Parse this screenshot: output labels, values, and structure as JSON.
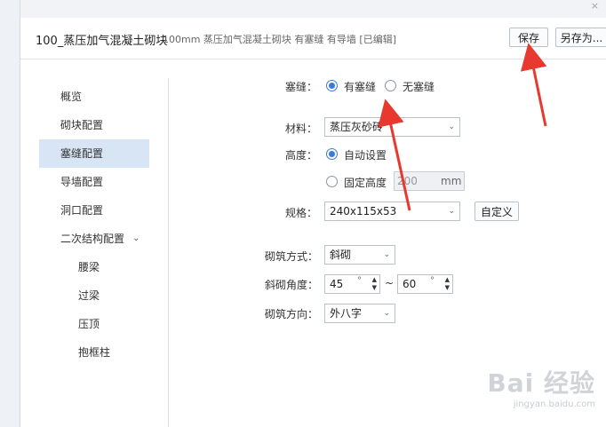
{
  "window": {
    "title": "100_蒸压加气混凝土砌块",
    "subtitle": "100mm 蒸压加气混凝土砌块 有塞缝 有导墙 [已编辑]",
    "close_glyph": "×"
  },
  "toolbar": {
    "save_label": "保存",
    "save_as_label": "另存为..."
  },
  "sidebar": {
    "items": [
      {
        "label": "概览"
      },
      {
        "label": "砌块配置"
      },
      {
        "label": "塞缝配置"
      },
      {
        "label": "导墙配置"
      },
      {
        "label": "洞口配置"
      },
      {
        "label": "二次结构配置"
      },
      {
        "label": "腰梁"
      },
      {
        "label": "过梁"
      },
      {
        "label": "压顶"
      },
      {
        "label": "抱框柱"
      }
    ],
    "active_index": 2,
    "chevron": "⌄"
  },
  "form": {
    "caulk": {
      "label": "塞缝：",
      "options": [
        "有塞缝",
        "无塞缝"
      ],
      "selected": "有塞缝"
    },
    "material": {
      "label": "材料：",
      "value": "蒸压灰砂砖"
    },
    "height": {
      "label": "高度：",
      "options": [
        "自动设置",
        "固定高度"
      ],
      "selected": "自动设置",
      "fixed_value": "200",
      "unit": "mm"
    },
    "spec": {
      "label": "规格：",
      "value": "240x115x53",
      "custom_label": "自定义"
    },
    "method": {
      "label": "砌筑方式：",
      "value": "斜砌"
    },
    "angle": {
      "label": "斜砌角度：",
      "from": "45",
      "to": "60",
      "unit": "°",
      "separator": "~"
    },
    "direction": {
      "label": "砌筑方向：",
      "value": "外八字"
    }
  },
  "watermark": {
    "logo": "Bai 经验",
    "url": "jingyan.baidu.com"
  },
  "colors": {
    "accent": "#3a7bd5",
    "active_nav": "#d7e5f4",
    "arrow": "#e8392f"
  }
}
